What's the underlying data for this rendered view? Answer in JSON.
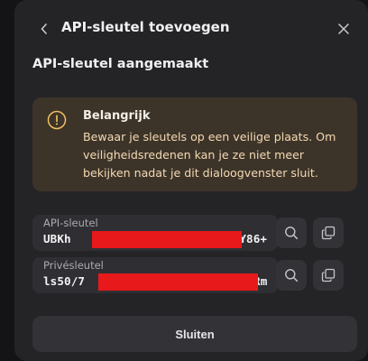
{
  "header": {
    "title": "API-sleutel toevoegen",
    "back_icon": "chevron-left-icon",
    "close_icon": "close-icon"
  },
  "subtitle": "API-sleutel aangemaakt",
  "warning": {
    "icon": "warning-circle-icon",
    "title": "Belangrijk",
    "body": "Bewaar je sleutels op een veilige plaats. Om veiligheidsredenen kan je ze niet meer bekijken nadat je dit dialoogvenster sluit."
  },
  "fields": [
    {
      "label": "API-sleutel",
      "value_start": "UBKh",
      "value_end": "HmY86+",
      "reveal_icon": "search-icon",
      "copy_icon": "copy-icon"
    },
    {
      "label": "Privésleutel",
      "value_start": "ls50/7",
      "value_end": "cwlRm",
      "reveal_icon": "search-icon",
      "copy_icon": "copy-icon"
    }
  ],
  "footer": {
    "close_label": "Sluiten"
  },
  "colors": {
    "dialog_bg": "#242427",
    "warning_bg": "#3d3429",
    "warning_text": "#f3d9b3",
    "redaction": "#e8191b"
  }
}
